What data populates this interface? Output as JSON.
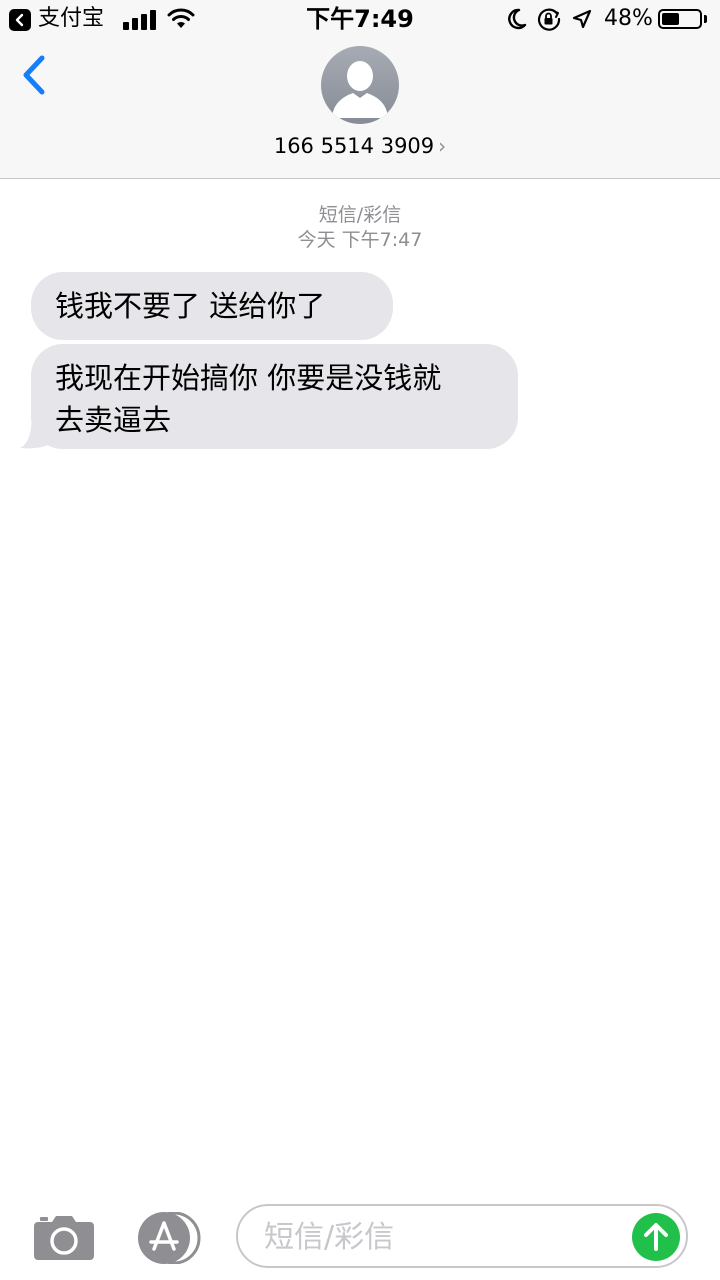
{
  "status_bar": {
    "back_app": "支付宝",
    "time": "下午7:49",
    "battery_percent": "48%",
    "battery_level": 0.48,
    "signal_bars": 4,
    "icons": [
      "back-app-icon",
      "signal-icon",
      "wifi-icon",
      "moon-icon",
      "orientation-lock-icon",
      "location-icon",
      "battery-icon"
    ]
  },
  "header": {
    "contact": "166 5514 3909",
    "chevron": "›",
    "icons": [
      "back-chevron-icon",
      "avatar-icon"
    ]
  },
  "conversation": {
    "service": "短信/彩信",
    "timestamp": "今天 下午7:47",
    "messages": [
      {
        "direction": "incoming",
        "text": "钱我不要了 送给你了"
      },
      {
        "direction": "incoming",
        "lines": [
          "我现在开始搞你 你要是没钱就",
          "去卖逼去"
        ]
      }
    ]
  },
  "composer": {
    "placeholder": "短信/彩信",
    "value": "",
    "icons": [
      "camera-icon",
      "app-store-icon",
      "send-arrow-icon"
    ]
  },
  "colors": {
    "accent_blue": "#147efb",
    "bubble_gray": "#e5e5ea",
    "send_green": "#21c04a",
    "meta_gray": "#8e8e93"
  }
}
